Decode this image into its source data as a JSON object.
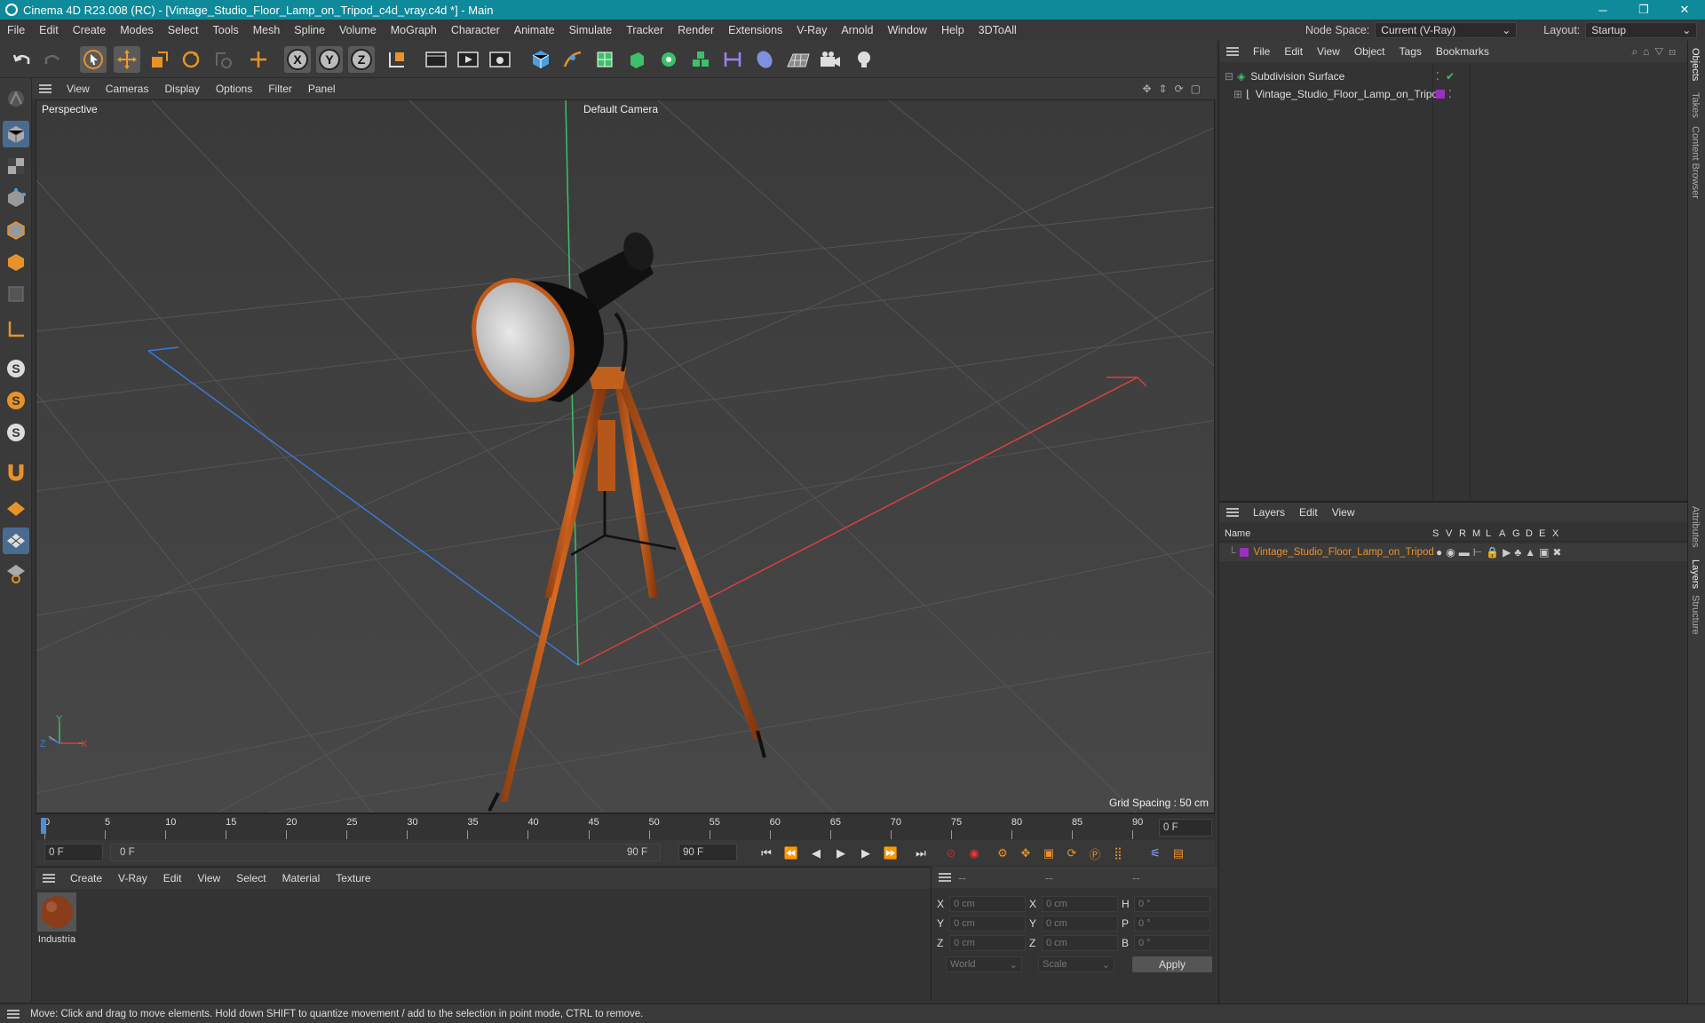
{
  "window": {
    "title": "Cinema 4D R23.008 (RC) - [Vintage_Studio_Floor_Lamp_on_Tripod_c4d_vray.c4d *] - Main",
    "controls": [
      "─",
      "❐",
      "✕"
    ]
  },
  "menubar": {
    "items": [
      "File",
      "Edit",
      "Create",
      "Modes",
      "Select",
      "Tools",
      "Mesh",
      "Spline",
      "Volume",
      "MoGraph",
      "Character",
      "Animate",
      "Simulate",
      "Tracker",
      "Render",
      "Extensions",
      "V-Ray",
      "Arnold",
      "Window",
      "Help",
      "3DToAll"
    ],
    "node_space_label": "Node Space:",
    "node_space_value": "Current (V-Ray)",
    "layout_label": "Layout:",
    "layout_value": "Startup"
  },
  "toolbar": {
    "icons": [
      "undo-icon",
      "redo-icon",
      "select-cursor-icon",
      "move-icon",
      "scale-icon",
      "rotate-icon",
      "recent-tools-icon",
      "add-icon",
      "x-axis-icon",
      "y-axis-icon",
      "z-axis-icon",
      "coordinate-system-icon",
      "render-view-icon",
      "render-active-icon",
      "render-settings-icon",
      "cube-icon",
      "pen-icon",
      "subdivision-icon",
      "extrude-icon",
      "mograph-cloner-icon",
      "field-icon",
      "deformer-icon",
      "scene-floor-icon",
      "camera-icon",
      "light-icon"
    ],
    "axis_labels": [
      "X",
      "Y",
      "Z"
    ]
  },
  "viewport": {
    "menu": [
      "View",
      "Cameras",
      "Display",
      "Options",
      "Filter",
      "Panel"
    ],
    "projection": "Perspective",
    "camera": "Default Camera",
    "grid_spacing": "Grid Spacing : 50 cm",
    "axis_labels": {
      "x": "X",
      "y": "Y",
      "z": "Z"
    }
  },
  "timeline": {
    "ticks": [
      "0",
      "5",
      "10",
      "15",
      "20",
      "25",
      "30",
      "35",
      "40",
      "45",
      "50",
      "55",
      "60",
      "65",
      "70",
      "75",
      "80",
      "85",
      "90"
    ],
    "current_frame_right": "0 F"
  },
  "transport": {
    "start_field": "0 F",
    "range_start": "0 F",
    "range_end": "90 F",
    "end_field": "90 F"
  },
  "materials": {
    "menu": [
      "Create",
      "V-Ray",
      "Edit",
      "View",
      "Select",
      "Material",
      "Texture"
    ],
    "items": [
      {
        "name": "Industria"
      }
    ]
  },
  "coordinates": {
    "headers": [
      "--",
      "--",
      "--"
    ],
    "rows": [
      {
        "a": "X",
        "av": "0 cm",
        "b": "X",
        "bv": "0 cm",
        "c": "H",
        "cv": "0 °"
      },
      {
        "a": "Y",
        "av": "0 cm",
        "b": "Y",
        "bv": "0 cm",
        "c": "P",
        "cv": "0 °"
      },
      {
        "a": "Z",
        "av": "0 cm",
        "b": "Z",
        "bv": "0 cm",
        "c": "B",
        "cv": "0 °"
      }
    ],
    "mode1": "World",
    "mode2": "Scale",
    "apply": "Apply"
  },
  "objects": {
    "menu": [
      "File",
      "Edit",
      "View",
      "Object",
      "Tags",
      "Bookmarks"
    ],
    "items": [
      {
        "name": "Subdivision Surface"
      },
      {
        "name": "Vintage_Studio_Floor_Lamp_on_Tripod"
      }
    ]
  },
  "layers": {
    "menu": [
      "Layers",
      "Edit",
      "View"
    ],
    "name_header": "Name",
    "flag_headers": [
      "S",
      "V",
      "R",
      "M",
      "L",
      "A",
      "G",
      "D",
      "E",
      "X"
    ],
    "items": [
      {
        "name": "Vintage_Studio_Floor_Lamp_on_Tripod",
        "color": "#9b30c0"
      }
    ]
  },
  "side_tabs": [
    "Objects",
    "Takes",
    "Content Browser",
    "Attributes",
    "Layers",
    "Structure"
  ],
  "status": "Move: Click and drag to move elements. Hold down SHIFT to quantize movement / add to the selection in point mode, CTRL to remove.",
  "colors": {
    "title_bar": "#0e8a9a",
    "accent": "#4a6b90",
    "orange": "#e8762a",
    "layer": "#9b30c0"
  }
}
